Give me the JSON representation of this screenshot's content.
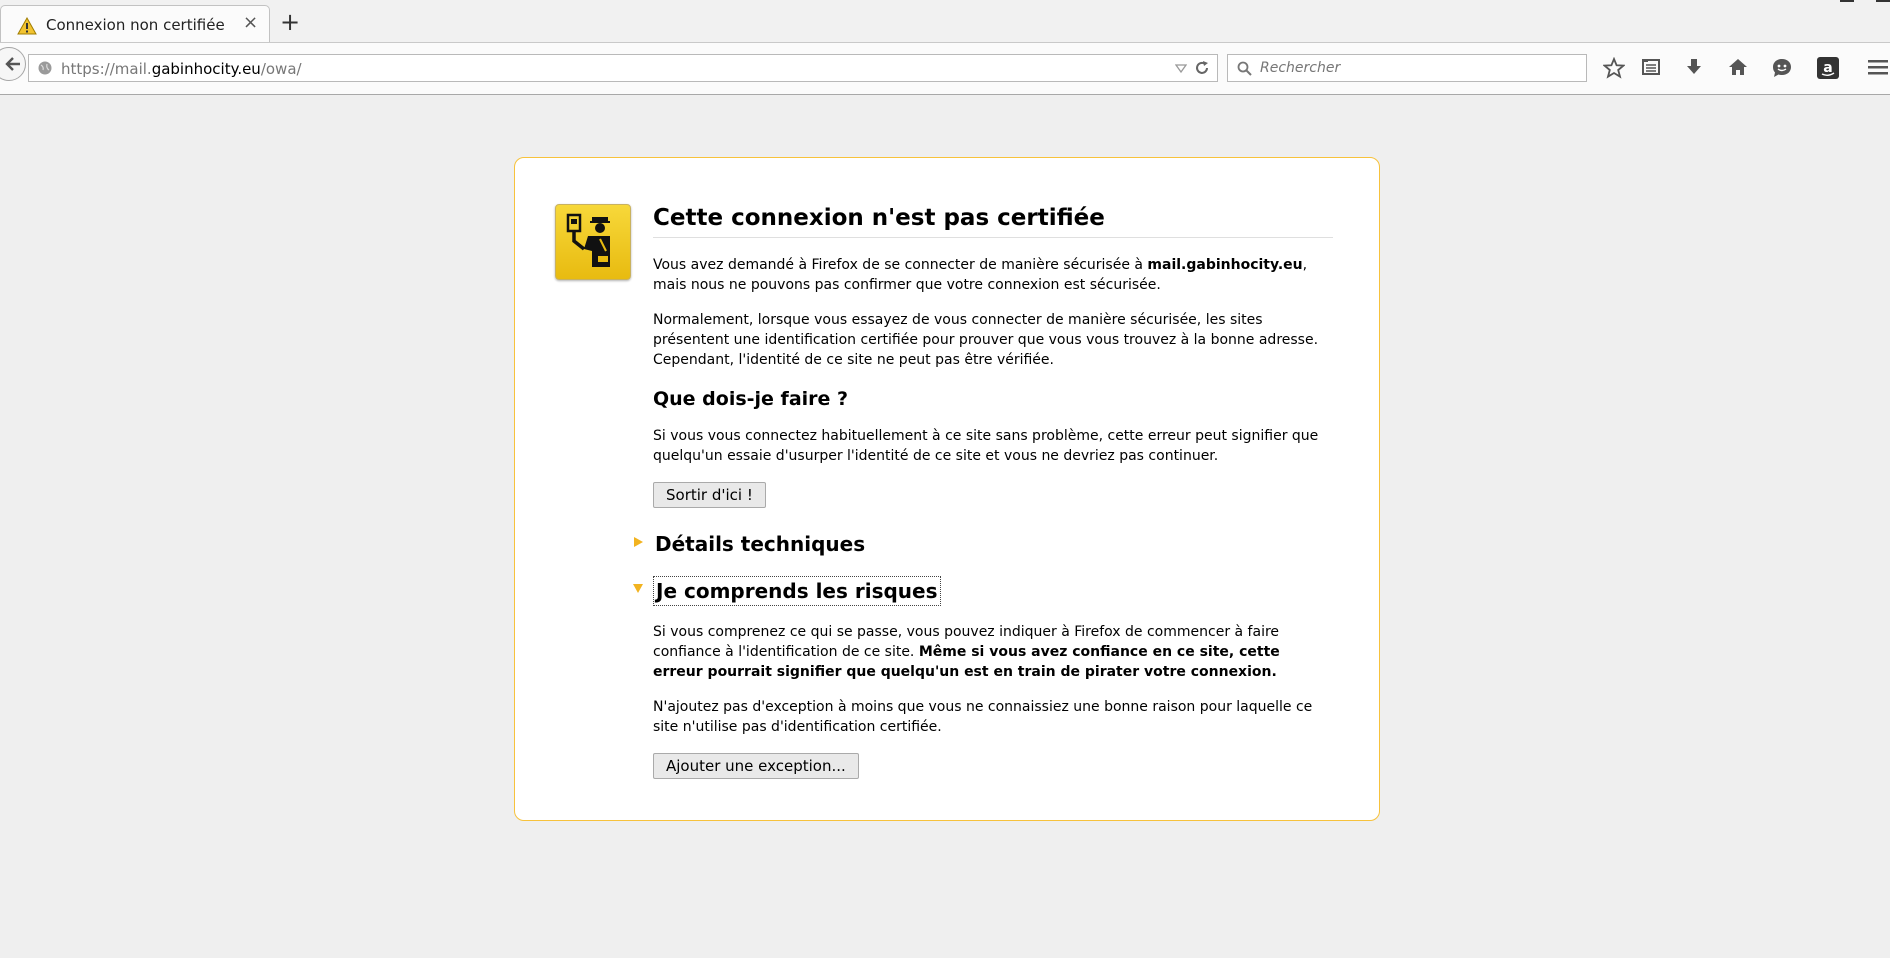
{
  "browser": {
    "tab": {
      "title": "Connexion non certifiée",
      "close": "×"
    },
    "new_tab": "+",
    "url": {
      "prefix": "https://mail.",
      "host": "gabinhocity.eu",
      "path": "/owa/"
    },
    "search": {
      "placeholder": "Rechercher"
    },
    "toolbar_icons": [
      "back-icon",
      "globe-icon",
      "dropmarker-icon",
      "reload-icon",
      "search-icon",
      "star-icon",
      "reading-list-icon",
      "download-icon",
      "home-icon",
      "hello-icon",
      "amazon-icon",
      "menu-icon"
    ]
  },
  "page": {
    "title": "Cette connexion n'est pas certifiée",
    "intro": {
      "before": "Vous avez demandé à Firefox de se connecter de manière sécurisée à ",
      "host": "mail.gabinhocity.eu",
      "after": ", mais nous ne pouvons pas confirmer que votre connexion est sécurisée."
    },
    "explanation": "Normalement, lorsque vous essayez de vous connecter de manière sécurisée, les sites présentent une identification certifiée pour prouver que vous vous trouvez à la bonne adresse. Cependant, l'identité de ce site ne peut pas être vérifiée.",
    "what_to_do": {
      "heading": "Que dois-je faire ?",
      "text": "Si vous vous connectez habituellement à ce site sans problème, cette erreur peut signifier que quelqu'un essaie d'usurper l'identité de ce site et vous ne devriez pas continuer.",
      "button": "Sortir d'ici !"
    },
    "technical_details": {
      "label": "Détails techniques",
      "expanded": false
    },
    "risks": {
      "label": "Je comprends les risques",
      "expanded": true,
      "text_plain": "Si vous comprenez ce qui se passe, vous pouvez indiquer à Firefox de commencer à faire confiance à l'identification de ce site. ",
      "text_bold": "Même si vous avez confiance en ce site, cette erreur pourrait signifier que quelqu'un est en train de pirater votre connexion.",
      "warning": "N'ajoutez pas d'exception à moins que vous ne connaissiez une bonne raison pour laquelle ce site n'utilise pas d'identification certifiée.",
      "button": "Ajouter une exception..."
    }
  },
  "colors": {
    "accent": "#f7c23c",
    "background": "#efefef",
    "box": "#ffffff"
  }
}
